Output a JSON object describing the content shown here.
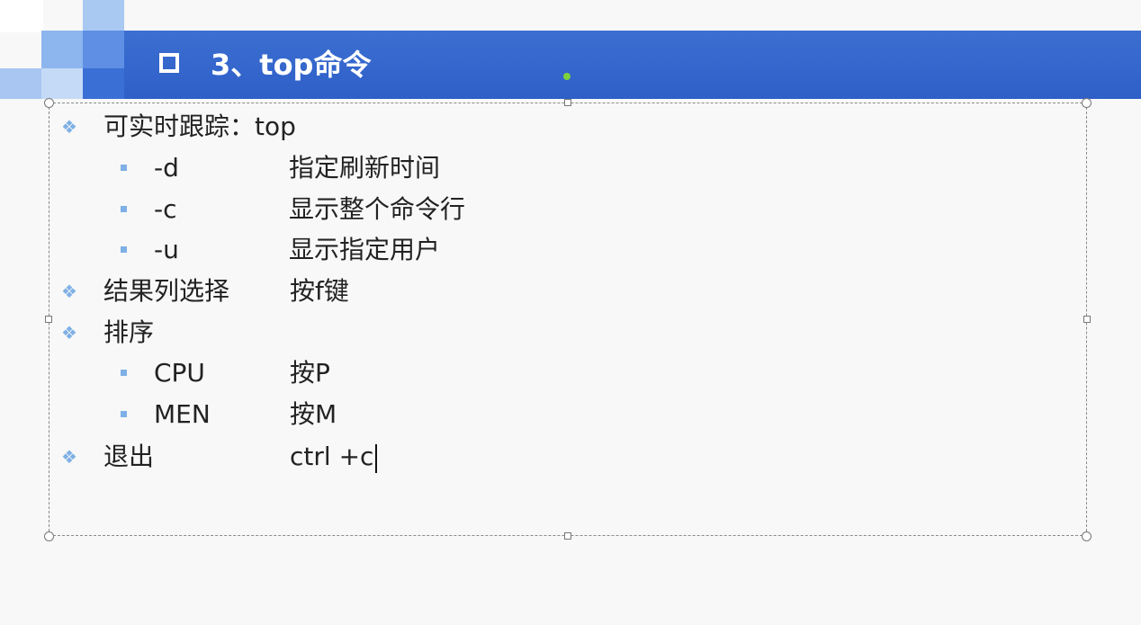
{
  "slide": {
    "title": "3、top命令",
    "accent_color": "#2e5fc8",
    "bullet_color": "#7fb0e6"
  },
  "items": [
    {
      "level": 1,
      "label": "可实时跟踪：top",
      "value": ""
    },
    {
      "level": 2,
      "label": "-d",
      "value": "指定刷新时间"
    },
    {
      "level": 2,
      "label": "-c",
      "value": "显示整个命令行"
    },
    {
      "level": 2,
      "label": "-u",
      "value": "显示指定用户"
    },
    {
      "level": 1,
      "label": "结果列选择",
      "value": "按f键"
    },
    {
      "level": 1,
      "label": "排序",
      "value": ""
    },
    {
      "level": 2,
      "label": "CPU",
      "value": "按P"
    },
    {
      "level": 2,
      "label": "MEN",
      "value": "按M"
    },
    {
      "level": 1,
      "label": "退出",
      "value": "ctrl +c"
    }
  ]
}
